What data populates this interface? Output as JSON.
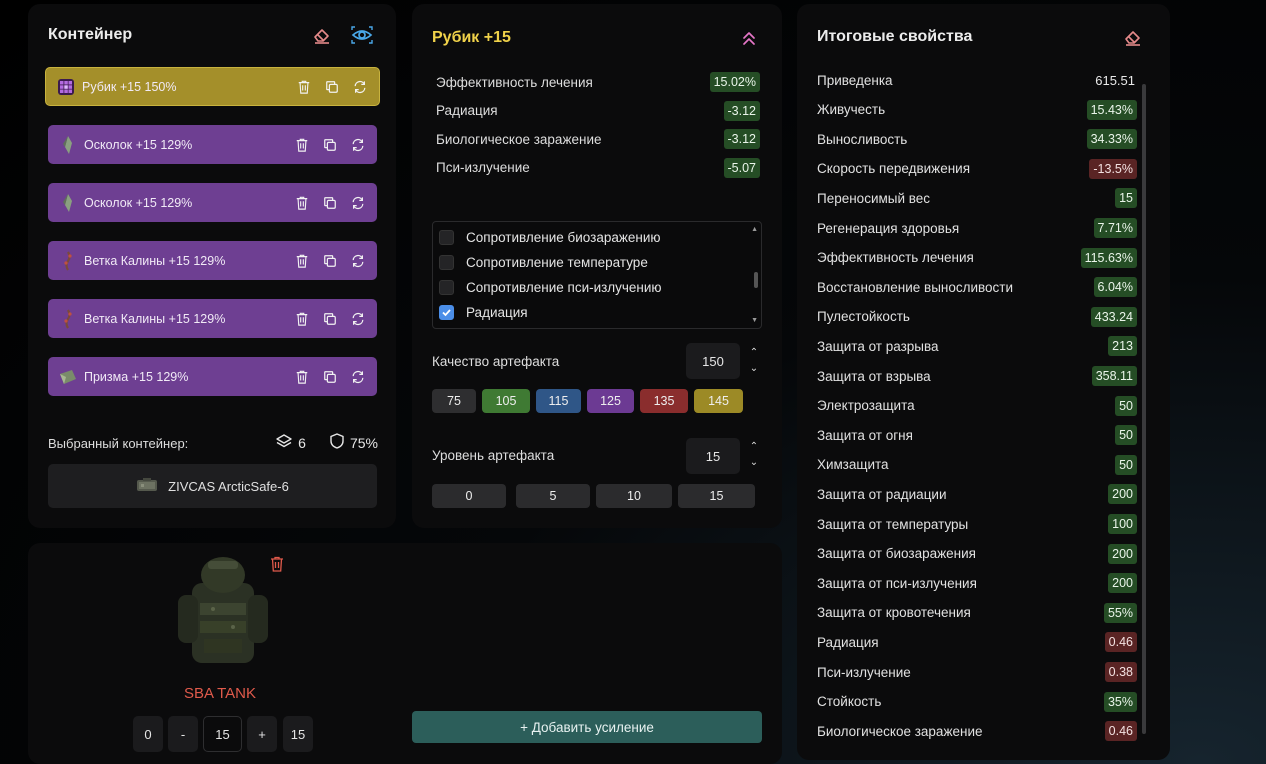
{
  "container": {
    "title": "Контейнер",
    "artifacts": [
      {
        "name": "Рубик",
        "level": "+15",
        "quality": "150%",
        "color": "#a48f2a",
        "icon": "rubik-cube-icon"
      },
      {
        "name": "Осколок",
        "level": "+15",
        "quality": "129%",
        "color": "#6e3f92",
        "icon": "shard-icon"
      },
      {
        "name": "Осколок",
        "level": "+15",
        "quality": "129%",
        "color": "#6e3f92",
        "icon": "shard-icon"
      },
      {
        "name": "Ветка Калины",
        "level": "+15",
        "quality": "129%",
        "color": "#6e3f92",
        "icon": "viburnum-branch-icon"
      },
      {
        "name": "Ветка Калины",
        "level": "+15",
        "quality": "129%",
        "color": "#6e3f92",
        "icon": "viburnum-branch-icon"
      },
      {
        "name": "Призма",
        "level": "+15",
        "quality": "129%",
        "color": "#6e3f92",
        "icon": "prism-icon"
      }
    ],
    "selected_label": "Выбранный контейнер:",
    "slots": "6",
    "protection": "75%",
    "container_name": "ZIVCAS ArcticSafe-6"
  },
  "detail": {
    "title": "Рубик +15",
    "properties": [
      {
        "name": "Эффективность лечения",
        "value": "15.02%",
        "tone": "positive"
      },
      {
        "name": "Радиация",
        "value": "-3.12",
        "tone": "positive"
      },
      {
        "name": "Биологическое заражение",
        "value": "-3.12",
        "tone": "positive"
      },
      {
        "name": "Пси-излучение",
        "value": "-5.07",
        "tone": "positive"
      }
    ],
    "checklist": [
      {
        "label": "Сопротивление биозаражению",
        "checked": false
      },
      {
        "label": "Сопротивление температуре",
        "checked": false
      },
      {
        "label": "Сопротивление пси-излучению",
        "checked": false
      },
      {
        "label": "Радиация",
        "checked": true
      }
    ],
    "quality_label": "Качество артефакта",
    "quality_value": "150",
    "quality_presets": [
      {
        "label": "75",
        "color": "#2e2e30"
      },
      {
        "label": "105",
        "color": "#3f7a33"
      },
      {
        "label": "115",
        "color": "#2f5687"
      },
      {
        "label": "125",
        "color": "#6c3a93"
      },
      {
        "label": "135",
        "color": "#8a2d2d"
      },
      {
        "label": "145",
        "color": "#9c8a26"
      }
    ],
    "level_label": "Уровень артефакта",
    "level_value": "15",
    "level_presets": [
      "0",
      "5",
      "10",
      "15"
    ]
  },
  "equipment": {
    "name": "SBA TANK",
    "min_label": "0",
    "minus_label": "-",
    "value": "15",
    "plus_label": "+",
    "max_label": "15",
    "add_button": "+ Добавить усиление"
  },
  "totals": {
    "title": "Итоговые свойства",
    "rows": [
      {
        "name": "Приведенка",
        "value": "615.51",
        "tone": "plain"
      },
      {
        "name": "Живучесть",
        "value": "15.43%",
        "tone": "positive"
      },
      {
        "name": "Выносливость",
        "value": "34.33%",
        "tone": "positive"
      },
      {
        "name": "Скорость передвижения",
        "value": "-13.5%",
        "tone": "negative"
      },
      {
        "name": "Переносимый вес",
        "value": "15",
        "tone": "positive"
      },
      {
        "name": "Регенерация здоровья",
        "value": "7.71%",
        "tone": "positive"
      },
      {
        "name": "Эффективность лечения",
        "value": "115.63%",
        "tone": "positive"
      },
      {
        "name": "Восстановление выносливости",
        "value": "6.04%",
        "tone": "positive"
      },
      {
        "name": "Пулестойкость",
        "value": "433.24",
        "tone": "positive"
      },
      {
        "name": "Защита от разрыва",
        "value": "213",
        "tone": "positive"
      },
      {
        "name": "Защита от взрыва",
        "value": "358.11",
        "tone": "positive"
      },
      {
        "name": "Электрозащита",
        "value": "50",
        "tone": "positive"
      },
      {
        "name": "Защита от огня",
        "value": "50",
        "tone": "positive"
      },
      {
        "name": "Химзащита",
        "value": "50",
        "tone": "positive"
      },
      {
        "name": "Защита от радиации",
        "value": "200",
        "tone": "positive"
      },
      {
        "name": "Защита от температуры",
        "value": "100",
        "tone": "positive"
      },
      {
        "name": "Защита от биозаражения",
        "value": "200",
        "tone": "positive"
      },
      {
        "name": "Защита от пси-излучения",
        "value": "200",
        "tone": "positive"
      },
      {
        "name": "Защита от кровотечения",
        "value": "55%",
        "tone": "positive"
      },
      {
        "name": "Радиация",
        "value": "0.46",
        "tone": "negative"
      },
      {
        "name": "Пси-излучение",
        "value": "0.38",
        "tone": "negative"
      },
      {
        "name": "Стойкость",
        "value": "35%",
        "tone": "positive"
      },
      {
        "name": "Биологическое заражение",
        "value": "0.46",
        "tone": "negative"
      }
    ]
  },
  "colors": {
    "accent_title": "#f0d24a",
    "positive_badge": "#254d25",
    "negative_badge": "#5a2424",
    "eraser": "#e58a8a",
    "eye": "#4aa8e8",
    "collapse": "#e676c8"
  }
}
